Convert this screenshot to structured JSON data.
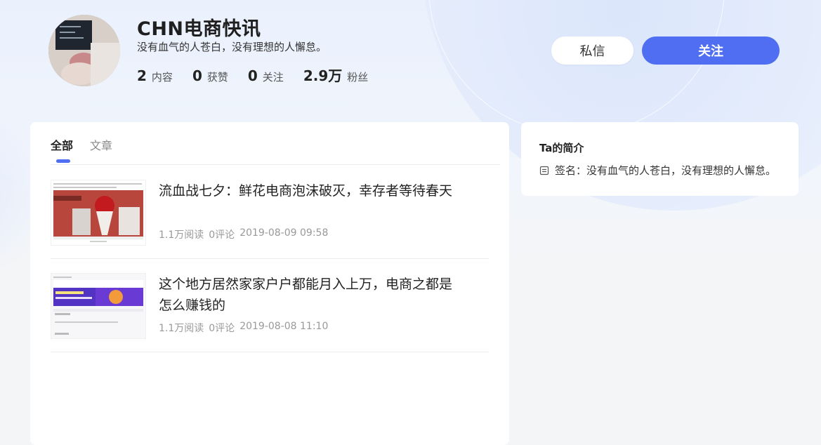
{
  "profile": {
    "name": "CHN电商快讯",
    "bio": "没有血气的人苍白，没有理想的人懈怠。",
    "stats": [
      {
        "num": "2",
        "label": "内容"
      },
      {
        "num": "0",
        "label": "获赞"
      },
      {
        "num": "0",
        "label": "关注"
      },
      {
        "num": "2.9万",
        "label": "粉丝"
      }
    ]
  },
  "actions": {
    "message_label": "私信",
    "follow_label": "关注"
  },
  "tabs": [
    {
      "label": "全部",
      "active": true
    },
    {
      "label": "文章",
      "active": false
    }
  ],
  "articles": [
    {
      "title": "流血战七夕：鲜花电商泡沫破灭，幸存者等待春天",
      "reads": "1.1万阅读",
      "comments": "0评论",
      "date": "2019-08-09 09:58"
    },
    {
      "title": "这个地方居然家家户户都能月入上万，电商之都是怎么赚钱的",
      "reads": "1.1万阅读",
      "comments": "0评论",
      "date": "2019-08-08 11:10"
    }
  ],
  "intro": {
    "title": "Ta的简介",
    "signature": "签名：没有血气的人苍白，没有理想的人懈怠。"
  },
  "colors": {
    "accent": "#4f6ef2"
  }
}
